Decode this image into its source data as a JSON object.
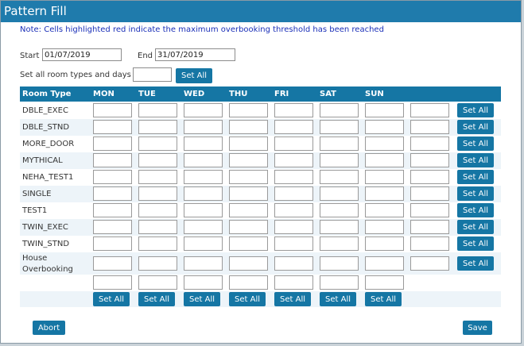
{
  "dialog": {
    "title": "Pattern Fill",
    "note": "Note: Cells highlighted red indicate the maximum overbooking threshold has been reached"
  },
  "dates": {
    "start_label": "Start",
    "start_value": "01/07/2019",
    "end_label": "End",
    "end_value": "31/07/2019"
  },
  "set_all_room_types": {
    "label": "Set all room types and days",
    "value": "",
    "button": "Set All"
  },
  "grid": {
    "headers": [
      "Room Type",
      "MON",
      "TUE",
      "WED",
      "THU",
      "FRI",
      "SAT",
      "SUN"
    ],
    "rows": [
      {
        "name": "DBLE_EXEC",
        "button": "Set All"
      },
      {
        "name": "DBLE_STND",
        "button": "Set All"
      },
      {
        "name": "MORE_DOOR",
        "button": "Set All"
      },
      {
        "name": "MYTHICAL",
        "button": "Set All"
      },
      {
        "name": "NEHA_TEST1",
        "button": "Set All"
      },
      {
        "name": "SINGLE",
        "button": "Set All"
      },
      {
        "name": "TEST1",
        "button": "Set All"
      },
      {
        "name": "TWIN_EXEC",
        "button": "Set All"
      },
      {
        "name": "TWIN_STND",
        "button": "Set All"
      },
      {
        "name": "House Overbooking",
        "button": "Set All"
      }
    ],
    "column_buttons": [
      "Set All",
      "Set All",
      "Set All",
      "Set All",
      "Set All",
      "Set All",
      "Set All"
    ]
  },
  "footer": {
    "abort": "Abort",
    "save": "Save"
  },
  "colors": {
    "title_bar": "#1f7bac",
    "button": "#1576a4",
    "note_text": "#1a2fb8",
    "alt_row": "#edf4f9"
  }
}
